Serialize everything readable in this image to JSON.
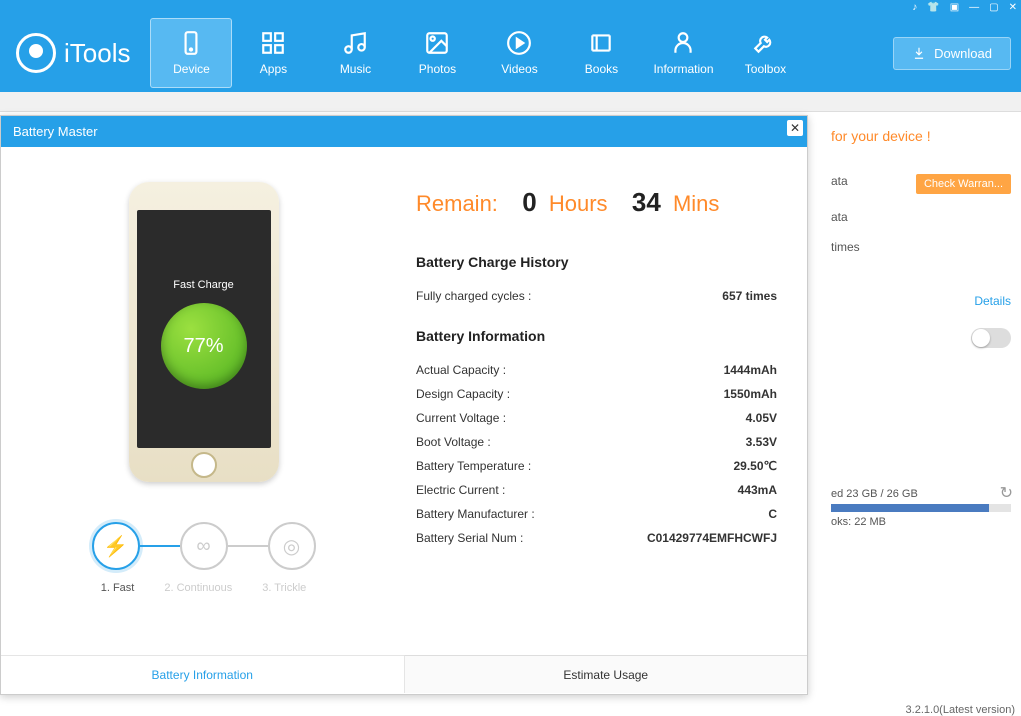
{
  "app": {
    "name": "iTools",
    "version": "3.2.1.0(Latest version)"
  },
  "nav": {
    "items": [
      {
        "label": "Device"
      },
      {
        "label": "Apps"
      },
      {
        "label": "Music"
      },
      {
        "label": "Photos"
      },
      {
        "label": "Videos"
      },
      {
        "label": "Books"
      },
      {
        "label": "Information"
      },
      {
        "label": "Toolbox"
      }
    ],
    "download": "Download"
  },
  "side": {
    "promo": "for your device !",
    "check": "Check  Warran...",
    "ata1": "ata",
    "ata2": "ata",
    "times": "times",
    "details": "Details",
    "storage_text": "ed 23 GB / 26 GB",
    "oks": "oks: 22 MB"
  },
  "modal": {
    "title": "Battery Master",
    "phone": {
      "mode_label": "Fast Charge",
      "percent": "77%"
    },
    "modes": {
      "m1": "1. Fast",
      "m2": "2. Continuous",
      "m3": "3. Trickle"
    },
    "remain": {
      "label": "Remain:",
      "hours_n": "0",
      "hours_u": "Hours",
      "mins_n": "34",
      "mins_u": "Mins"
    },
    "history": {
      "heading": "Battery Charge History",
      "cycles_label": "Fully charged cycles :",
      "cycles_value": "657 times"
    },
    "info": {
      "heading": "Battery Information",
      "rows": [
        {
          "k": "Actual  Capacity :",
          "v": "1444mAh"
        },
        {
          "k": "Design  Capacity :",
          "v": "1550mAh"
        },
        {
          "k": "Current  Voltage :",
          "v": "4.05V"
        },
        {
          "k": "Boot  Voltage :",
          "v": "3.53V"
        },
        {
          "k": "Battery  Temperature :",
          "v": "29.50℃"
        },
        {
          "k": "Electric  Current :",
          "v": "443mA"
        },
        {
          "k": "Battery  Manufacturer :",
          "v": "C"
        },
        {
          "k": "Battery  Serial  Num :",
          "v": "C01429774EMFHCWFJ"
        }
      ]
    },
    "tabs": {
      "t1": "Battery Information",
      "t2": "Estimate Usage"
    }
  }
}
